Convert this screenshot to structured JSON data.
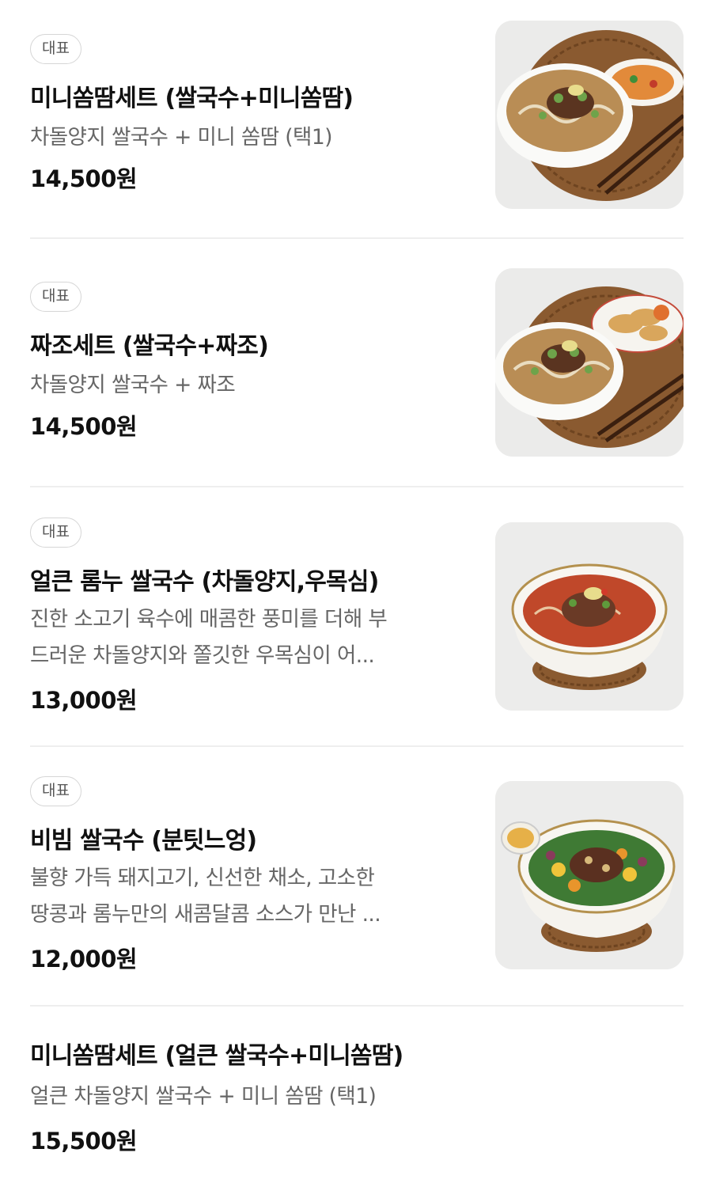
{
  "menu": {
    "items": [
      {
        "badge": "대표",
        "name": "미니쏨땀세트 (쌀국수+미니쏨땀)",
        "desc_lines": [
          "차돌양지 쌀국수 + 미니 쏨땀 (택1)"
        ],
        "price": "14,500원"
      },
      {
        "badge": "대표",
        "name": "짜조세트 (쌀국수+짜조)",
        "desc_lines": [
          "차돌양지 쌀국수 + 짜조"
        ],
        "price": "14,500원"
      },
      {
        "badge": "대표",
        "name": "얼큰 롬누 쌀국수 (차돌양지,우목심)",
        "desc_lines": [
          "진한 소고기 육수에 매콤한 풍미를 더해 부",
          "드러운 차돌양지와 쫄깃한 우목심이 어..."
        ],
        "price": "13,000원"
      },
      {
        "badge": "대표",
        "name": "비빔 쌀국수 (분팃느엉)",
        "desc_lines": [
          "불향 가득 돼지고기, 신선한 채소, 고소한",
          "땅콩과 롬누만의 새콤달콤 소스가 만난 ..."
        ],
        "price": "12,000원"
      },
      {
        "badge": "",
        "name": "미니쏨땀세트 (얼큰 쌀국수+미니쏨땀)",
        "desc_lines": [
          "얼큰 차돌양지 쌀국수 + 미니 쏨땀 (택1)"
        ],
        "price": "15,500원"
      }
    ]
  },
  "colors": {
    "text_primary": "#111111",
    "text_secondary": "#666666",
    "badge_border": "#d6d6d6",
    "divider": "#eeeeee",
    "thumb_bg": "#ededeb"
  }
}
